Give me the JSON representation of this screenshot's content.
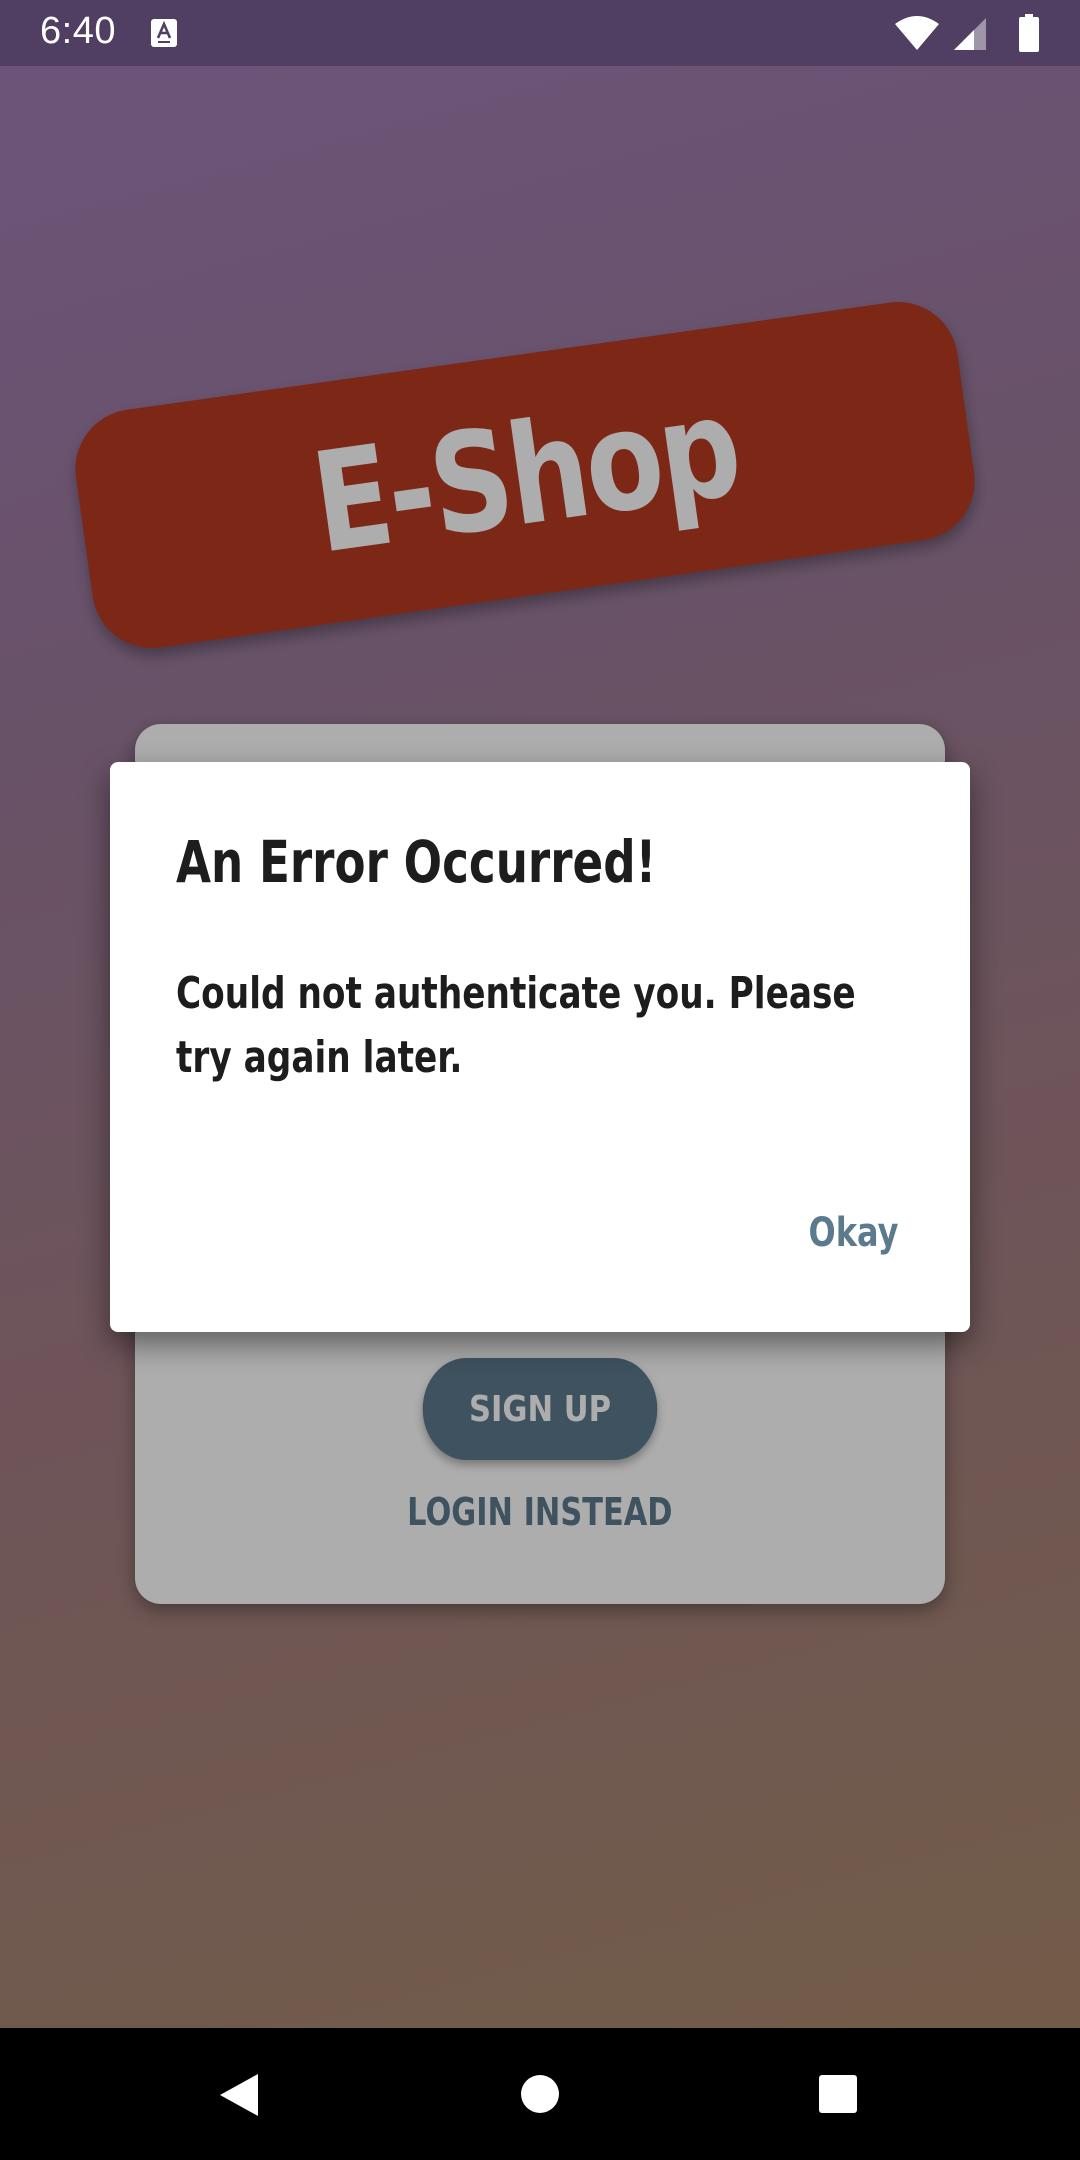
{
  "status_bar": {
    "time": "6:40",
    "icons": [
      "a-notification-icon",
      "wifi-icon",
      "signal-icon",
      "battery-icon"
    ]
  },
  "background": {
    "logo_text": "E-Shop",
    "logo_color": "#b83a22",
    "signup_label": "SIGN UP",
    "login_instead_label": "LOGIN INSTEAD",
    "accent_color": "#5c7a8d"
  },
  "dialog": {
    "title": "An Error Occurred!",
    "message": "Could not authenticate you. Please try again later.",
    "okay_label": "Okay"
  },
  "nav_bar": {
    "icons": [
      "back-icon",
      "home-icon",
      "recents-icon"
    ]
  }
}
